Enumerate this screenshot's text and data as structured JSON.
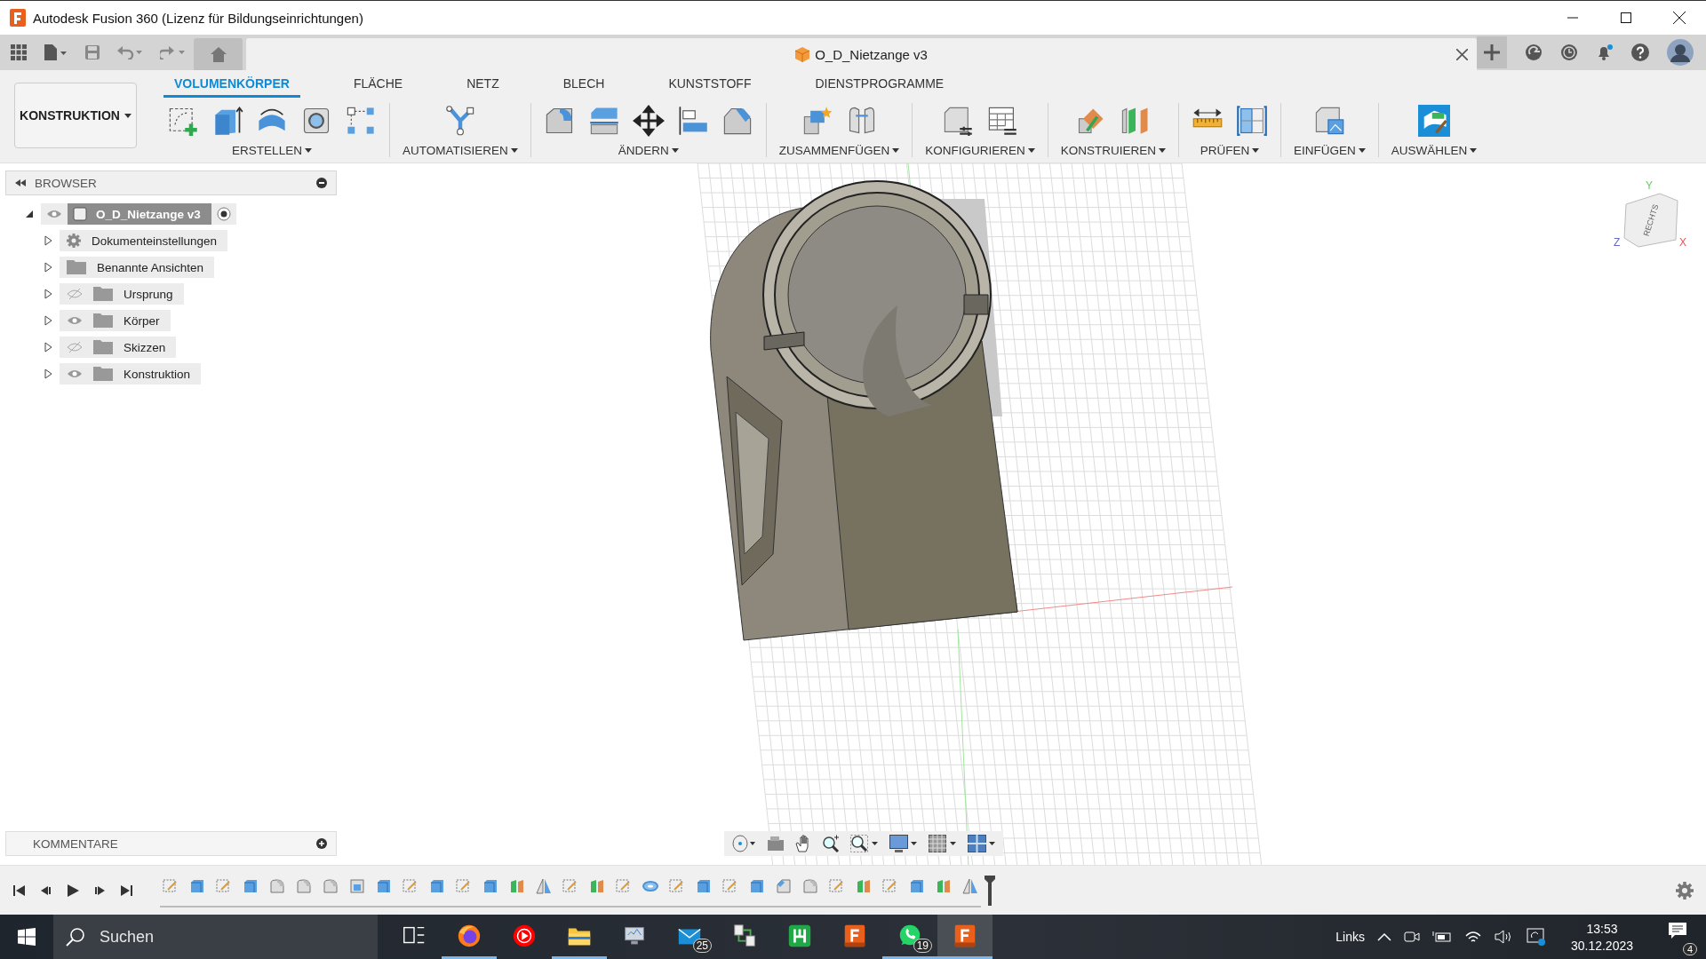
{
  "window": {
    "title": "Autodesk Fusion 360 (Lizenz für Bildungseinrichtungen)"
  },
  "document_tab": {
    "title": "O_D_Nietzange v3"
  },
  "workspace": {
    "label": "KONSTRUKTION"
  },
  "ribbon_tabs": [
    {
      "label": "VOLUMENKÖRPER",
      "selected": true
    },
    {
      "label": "FLÄCHE",
      "selected": false
    },
    {
      "label": "NETZ",
      "selected": false
    },
    {
      "label": "BLECH",
      "selected": false
    },
    {
      "label": "KUNSTSTOFF",
      "selected": false
    },
    {
      "label": "DIENSTPROGRAMME",
      "selected": false
    }
  ],
  "tool_groups": [
    {
      "label": "ERSTELLEN",
      "tools": [
        {
          "kind": "sketch"
        },
        {
          "kind": "extrude"
        },
        {
          "kind": "revolve"
        },
        {
          "kind": "hole"
        },
        {
          "kind": "pattern"
        }
      ]
    },
    {
      "label": "AUTOMATISIEREN",
      "tools": [
        {
          "kind": "automate"
        }
      ]
    },
    {
      "label": "ÄNDERN",
      "tools": [
        {
          "kind": "fillet"
        },
        {
          "kind": "presspull"
        },
        {
          "kind": "move"
        },
        {
          "kind": "align"
        },
        {
          "kind": "chamfer"
        }
      ]
    },
    {
      "label": "ZUSAMMENFÜGEN",
      "tools": [
        {
          "kind": "new-component"
        },
        {
          "kind": "joint"
        }
      ]
    },
    {
      "label": "KONFIGURIEREN",
      "tools": [
        {
          "kind": "configure"
        },
        {
          "kind": "config-table"
        }
      ]
    },
    {
      "label": "KONSTRUIEREN",
      "tools": [
        {
          "kind": "plane-angle"
        },
        {
          "kind": "midplane"
        }
      ]
    },
    {
      "label": "PRÜFEN",
      "tools": [
        {
          "kind": "measure"
        },
        {
          "kind": "section"
        }
      ]
    },
    {
      "label": "EINFÜGEN",
      "tools": [
        {
          "kind": "insert"
        }
      ]
    },
    {
      "label": "AUSWÄHLEN",
      "tools": [
        {
          "kind": "select"
        }
      ]
    }
  ],
  "browser": {
    "title": "BROWSER",
    "root": {
      "label": "O_D_Nietzange v3",
      "expanded": true,
      "visible": true,
      "active": true,
      "children": [
        {
          "label": "Dokumenteinstellungen",
          "kind": "settings",
          "expanded": false
        },
        {
          "label": "Benannte Ansichten",
          "kind": "folder",
          "expanded": false
        },
        {
          "label": "Ursprung",
          "kind": "folder",
          "expanded": false,
          "visible": false
        },
        {
          "label": "Körper",
          "kind": "folder",
          "expanded": false,
          "visible": true
        },
        {
          "label": "Skizzen",
          "kind": "folder",
          "expanded": false,
          "visible": false
        },
        {
          "label": "Konstruktion",
          "kind": "folder",
          "expanded": false,
          "visible": true
        }
      ]
    }
  },
  "view_cube": {
    "face": "RECHTS",
    "axes": [
      "Y",
      "Z",
      "X"
    ]
  },
  "comments": {
    "title": "KOMMENTARE"
  },
  "timeline": {
    "features": [
      {
        "kind": "sketch"
      },
      {
        "kind": "extrude"
      },
      {
        "kind": "sketch"
      },
      {
        "kind": "extrude"
      },
      {
        "kind": "fillet"
      },
      {
        "kind": "fillet"
      },
      {
        "kind": "fillet"
      },
      {
        "kind": "shell"
      },
      {
        "kind": "extrude"
      },
      {
        "kind": "sketch"
      },
      {
        "kind": "extrude"
      },
      {
        "kind": "sketch"
      },
      {
        "kind": "extrude"
      },
      {
        "kind": "plane"
      },
      {
        "kind": "mirror"
      },
      {
        "kind": "sketch"
      },
      {
        "kind": "plane"
      },
      {
        "kind": "sketch"
      },
      {
        "kind": "hole"
      },
      {
        "kind": "sketch"
      },
      {
        "kind": "extrude"
      },
      {
        "kind": "sketch"
      },
      {
        "kind": "extrude"
      },
      {
        "kind": "chamfer"
      },
      {
        "kind": "fillet"
      },
      {
        "kind": "sketch"
      },
      {
        "kind": "plane"
      },
      {
        "kind": "sketch"
      },
      {
        "kind": "extrude"
      },
      {
        "kind": "plane"
      },
      {
        "kind": "mirror"
      }
    ]
  },
  "taskbar": {
    "search": {
      "placeholder": "Suchen"
    },
    "apps": [
      {
        "kind": "task-view",
        "running": false,
        "selected": false
      },
      {
        "kind": "firefox",
        "running": true,
        "selected": false
      },
      {
        "kind": "music",
        "running": false,
        "selected": false
      },
      {
        "kind": "explorer",
        "running": true,
        "selected": false
      },
      {
        "kind": "monitor",
        "running": false,
        "selected": false
      },
      {
        "kind": "mail",
        "running": false,
        "selected": false,
        "badge": "25"
      },
      {
        "kind": "network",
        "running": false,
        "selected": false
      },
      {
        "kind": "green-app",
        "running": false,
        "selected": false
      },
      {
        "kind": "fusion",
        "running": false,
        "selected": false
      },
      {
        "kind": "whatsapp",
        "running": true,
        "selected": false,
        "badge": "19"
      },
      {
        "kind": "fusion",
        "running": true,
        "selected": true
      }
    ],
    "tray": {
      "language": "Links",
      "time": "13:53",
      "date": "30.12.2023",
      "notifications": "4"
    }
  }
}
